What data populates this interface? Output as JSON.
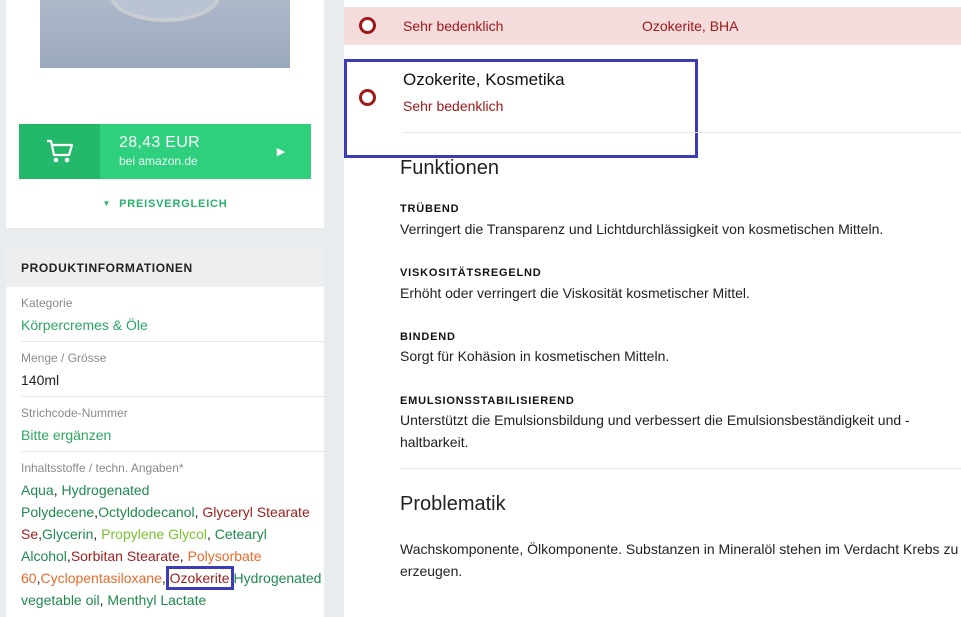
{
  "buy": {
    "price": "28,43 EUR",
    "source": "bei amazon.de",
    "price_compare": "PREISVERGLEICH"
  },
  "product_info": {
    "header": "PRODUKTINFORMATIONEN",
    "category_label": "Kategorie",
    "category_value": "Körpercremes & Öle",
    "amount_label": "Menge / Grösse",
    "amount_value": "140ml",
    "barcode_label": "Strichcode-Nummer",
    "barcode_value": "Bitte ergänzen",
    "ingredients_label": "Inhaltsstoffe / techn. Angaben*",
    "ingredients": [
      {
        "name": "Aqua",
        "sep": ", ",
        "color": "#1f8a4c"
      },
      {
        "name": "Hydrogenated Polydecene",
        "sep": ",",
        "color": "#1f8a4c"
      },
      {
        "name": "Octyldodecanol",
        "sep": ", ",
        "color": "#1f8a4c"
      },
      {
        "name": "Glyceryl Stearate Se",
        "sep": ",",
        "color": "#a02020"
      },
      {
        "name": "Glycerin",
        "sep": ", ",
        "color": "#1f8a4c"
      },
      {
        "name": "Propylene Glycol",
        "sep": ", ",
        "color": "#7ac22f"
      },
      {
        "name": "Cetearyl Alcohol",
        "sep": ",",
        "color": "#1f8a4c"
      },
      {
        "name": "Sorbitan Stearate",
        "sep": ", ",
        "color": "#a02020"
      },
      {
        "name": "Polysorbate 60",
        "sep": ",",
        "color": "#ec6a2a"
      },
      {
        "name": "Cyclopentasiloxane",
        "sep": ", ",
        "color": "#ec6a2a"
      },
      {
        "name": "Ozokerite",
        "sep": ",",
        "color": "#a02020"
      },
      {
        "name": "Hydrogenated vegetable oil",
        "sep": ", ",
        "color": "#1f8a4c"
      },
      {
        "name": "Menthyl Lactate",
        "sep": "",
        "color": "#1f8a4c"
      }
    ]
  },
  "risk_bar": {
    "level": "Sehr bedenklich",
    "ingredients": "Ozokerite, BHA"
  },
  "ingredient_detail": {
    "title": "Ozokerite, Kosmetika",
    "risk": "Sehr bedenklich",
    "functions_title": "Funktionen",
    "functions": [
      {
        "label": "TRÜBEND",
        "desc": "Verringert die Transparenz und Lichtdurchlässigkeit von kosmetischen Mitteln."
      },
      {
        "label": "VISKOSITÄTSREGELND",
        "desc": "Erhöht oder verringert die Viskosität kosmetischer Mittel."
      },
      {
        "label": "BINDEND",
        "desc": "Sorgt für Kohäsion in kosmetischen Mitteln."
      },
      {
        "label": "EMULSIONSSTABILISIEREND",
        "desc": "Unterstützt die Emulsionsbildung und verbessert die Emulsionsbeständigkeit und -haltbarkeit."
      }
    ],
    "problem_title": "Problematik",
    "problem_text": "Wachskomponente, Ölkomponente. Substanzen in Mineralöl stehen im Verdacht Krebs zu erzeugen."
  },
  "colors": {
    "green": "#2fd07d",
    "risk_red": "#a01818",
    "highlight": "#3c3cb8"
  }
}
